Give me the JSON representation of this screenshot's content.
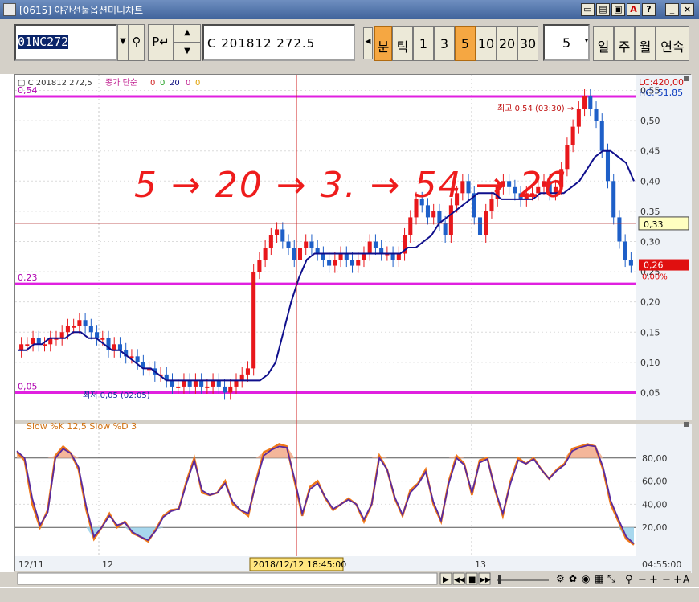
{
  "window": {
    "title": "[0615] 야간선물옵션미니차트",
    "icon": "app-chart-icon",
    "controls": [
      "window-icon-1",
      "window-icon-2",
      "print-icon",
      "edit-icon",
      "help-icon",
      "minimize-icon",
      "close-icon"
    ]
  },
  "toolbar": {
    "code": "01NC272",
    "p_label": "P",
    "name": "C  201812  272.5",
    "periods": [
      "분",
      "틱",
      "1",
      "3",
      "5",
      "10",
      "20",
      "30"
    ],
    "active_periods": [
      "분",
      "5"
    ],
    "count": "5",
    "ranges": [
      "일",
      "주",
      "월",
      "연속"
    ]
  },
  "price_pane": {
    "legend_name": "C  201812 272,5",
    "legend_ma": "종가  단순",
    "ma_values": [
      "0",
      "0",
      "20",
      "0",
      "0"
    ],
    "lc": "LC:420,00",
    "hc": "HC:-51,85",
    "y_ticks": [
      "0,55",
      "0,50",
      "0,45",
      "0,40",
      "0,35",
      "0,30",
      "0,25",
      "0,20",
      "0,15",
      "0,10",
      "0,05"
    ],
    "hline_labels": [
      "0,54",
      "0,23",
      "0,05"
    ],
    "max_label": "최고 0,54 (03:30)",
    "min_label": "최저 0,05 (02:05)",
    "crosshair_value": "0,33",
    "last_price": "0,26",
    "change_pct": "0,00%"
  },
  "stoch_pane": {
    "legend": "Slow %K 12,5   Slow %D 3",
    "y_ticks": [
      "80,00",
      "60,00",
      "40,00",
      "20,00"
    ]
  },
  "x_axis": {
    "labels": [
      "12/11",
      "12",
      "13"
    ],
    "crosshair_time": "2018/12/12 18:45:00",
    "end_time": "04:55:00"
  },
  "annotation": {
    "text": "5 → 20 → 3. → 54 → 26"
  },
  "colors": {
    "up": "#e8171b",
    "down": "#1e5fc8",
    "ma": "#0f0f8c",
    "hline": "#e020e0",
    "k_line": "#f07818",
    "d_line": "#5a2a9e",
    "overbought_fill": "#f4b69a",
    "oversold_fill": "#a8d8ee",
    "handwriting": "#ee1c1c"
  },
  "chart_data": {
    "type": "candlestick",
    "price_axis": {
      "min": 0.02,
      "max": 0.56
    },
    "stoch_axis": {
      "min": 0,
      "max": 100
    },
    "horizontal_lines": [
      0.54,
      0.23,
      0.05
    ],
    "crosshair_price": 0.33,
    "close": [
      0.13,
      0.13,
      0.14,
      0.13,
      0.13,
      0.14,
      0.14,
      0.15,
      0.16,
      0.16,
      0.17,
      0.16,
      0.15,
      0.14,
      0.14,
      0.12,
      0.13,
      0.12,
      0.11,
      0.11,
      0.1,
      0.09,
      0.09,
      0.08,
      0.08,
      0.07,
      0.06,
      0.06,
      0.07,
      0.06,
      0.07,
      0.06,
      0.06,
      0.07,
      0.06,
      0.05,
      0.06,
      0.07,
      0.08,
      0.09,
      0.25,
      0.27,
      0.29,
      0.31,
      0.32,
      0.3,
      0.29,
      0.27,
      0.29,
      0.3,
      0.29,
      0.28,
      0.27,
      0.26,
      0.27,
      0.28,
      0.27,
      0.26,
      0.27,
      0.28,
      0.3,
      0.29,
      0.28,
      0.28,
      0.27,
      0.28,
      0.31,
      0.34,
      0.37,
      0.36,
      0.34,
      0.35,
      0.33,
      0.31,
      0.36,
      0.38,
      0.4,
      0.38,
      0.34,
      0.31,
      0.35,
      0.37,
      0.39,
      0.4,
      0.39,
      0.38,
      0.37,
      0.38,
      0.38,
      0.39,
      0.4,
      0.38,
      0.39,
      0.42,
      0.46,
      0.49,
      0.52,
      0.54,
      0.52,
      0.5,
      0.45,
      0.4,
      0.34,
      0.3,
      0.27,
      0.26
    ],
    "ma20": [
      0.12,
      0.12,
      0.13,
      0.13,
      0.14,
      0.14,
      0.14,
      0.15,
      0.15,
      0.14,
      0.14,
      0.13,
      0.12,
      0.12,
      0.11,
      0.1,
      0.09,
      0.09,
      0.08,
      0.07,
      0.07,
      0.07,
      0.07,
      0.07,
      0.07,
      0.07,
      0.07,
      0.07,
      0.07,
      0.07,
      0.07,
      0.07,
      0.08,
      0.1,
      0.15,
      0.2,
      0.24,
      0.27,
      0.28,
      0.28,
      0.28,
      0.28,
      0.28,
      0.28,
      0.28,
      0.28,
      0.28,
      0.28,
      0.28,
      0.28,
      0.29,
      0.29,
      0.3,
      0.31,
      0.33,
      0.34,
      0.35,
      0.36,
      0.37,
      0.38,
      0.38,
      0.38,
      0.37,
      0.37,
      0.37,
      0.37,
      0.37,
      0.38,
      0.38,
      0.38,
      0.38,
      0.39,
      0.4,
      0.42,
      0.44,
      0.45,
      0.45,
      0.44,
      0.43,
      0.4
    ],
    "slow_k": [
      85,
      78,
      40,
      20,
      35,
      82,
      90,
      84,
      70,
      35,
      10,
      20,
      32,
      20,
      25,
      15,
      12,
      8,
      18,
      30,
      35,
      36,
      60,
      80,
      50,
      48,
      50,
      60,
      40,
      35,
      30,
      60,
      85,
      88,
      92,
      90,
      60,
      30,
      55,
      60,
      45,
      35,
      40,
      45,
      40,
      25,
      40,
      82,
      70,
      45,
      30,
      52,
      58,
      70,
      40,
      25,
      60,
      82,
      75,
      48,
      78,
      80,
      52,
      30,
      60,
      80,
      75,
      80,
      70,
      62,
      70,
      75,
      88,
      90,
      92,
      90,
      70,
      40,
      25,
      10,
      5
    ],
    "slow_d": [
      86,
      80,
      45,
      22,
      33,
      80,
      88,
      84,
      72,
      38,
      12,
      20,
      30,
      22,
      24,
      16,
      12,
      9,
      17,
      29,
      34,
      36,
      58,
      78,
      52,
      48,
      50,
      58,
      42,
      35,
      32,
      58,
      82,
      87,
      90,
      89,
      62,
      32,
      53,
      58,
      46,
      36,
      40,
      44,
      40,
      27,
      40,
      80,
      70,
      46,
      31,
      50,
      57,
      68,
      42,
      26,
      58,
      80,
      74,
      50,
      76,
      79,
      53,
      32,
      58,
      78,
      75,
      79,
      70,
      62,
      69,
      74,
      86,
      89,
      91,
      90,
      72,
      43,
      27,
      12,
      6
    ]
  }
}
